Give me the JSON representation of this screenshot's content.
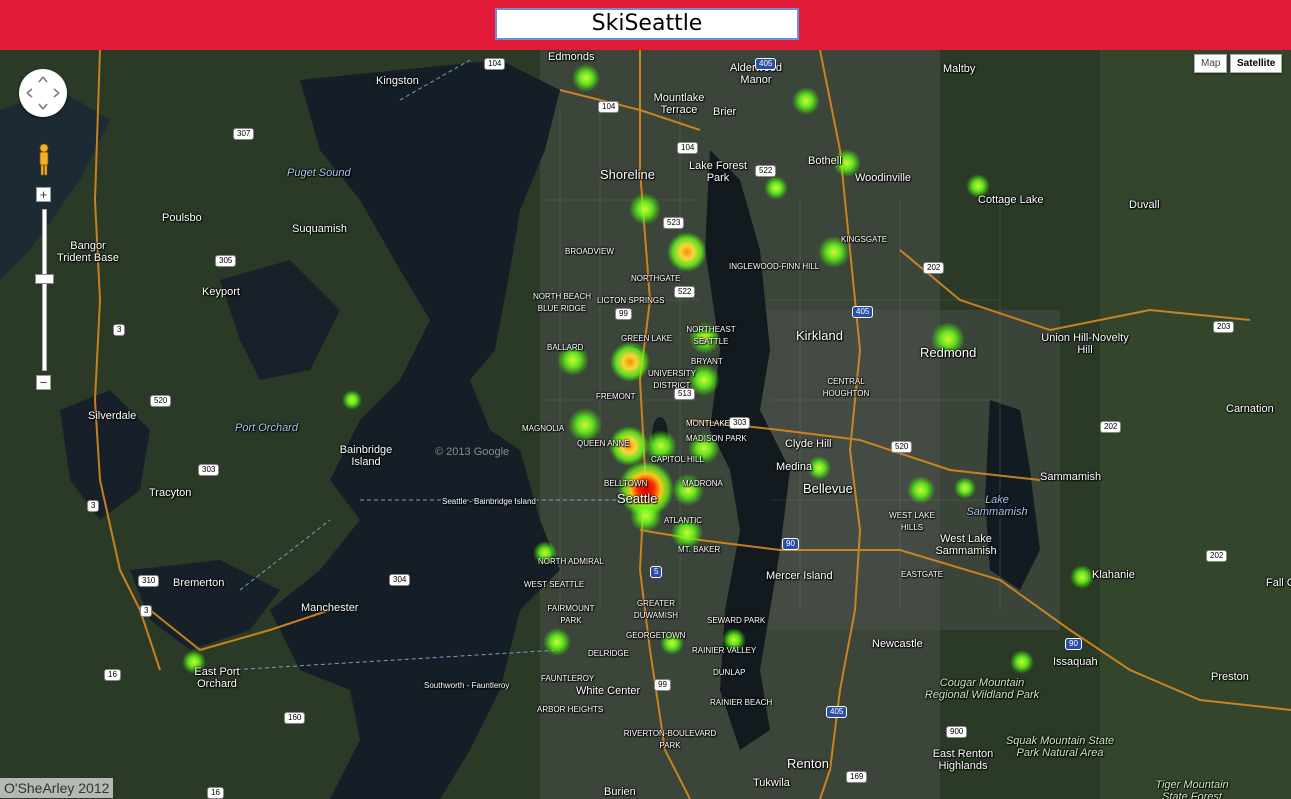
{
  "app": {
    "title": "SkiSeattle"
  },
  "map_type": {
    "map_label": "Map",
    "satellite_label": "Satellite",
    "active": "Satellite"
  },
  "zoom": {
    "in_label": "+",
    "out_label": "−"
  },
  "footer": {
    "copyright": "O'SheArley 2012"
  },
  "colors": {
    "header": "#e31b38",
    "heat_low": "#7cff2a",
    "heat_high": "#ff1a00"
  },
  "places": [
    "Edmonds",
    "Kingston",
    "Alderwood Manor",
    "Mountlake Terrace",
    "Brier",
    "Maltby",
    "Shoreline",
    "Lake Forest Park",
    "Bothell",
    "Woodinville",
    "Cottage Lake",
    "Duvall",
    "Puget Sound",
    "Poulsbo",
    "Suquamish",
    "Bangor Trident Base",
    "Keyport",
    "KINGSGATE",
    "INGLEWOOD-FINN HILL",
    "BROADVIEW",
    "NORTHGATE",
    "NORTH BEACH BLUE RIDGE",
    "LICTON SPRINGS",
    "Kirkland",
    "Redmond",
    "Union Hill-Novelty Hill",
    "BALLARD",
    "GREEN LAKE",
    "NORTHEAST SEATTLE",
    "BRYANT",
    "UNIVERSITY DISTRICT",
    "CENTRAL HOUGHTON",
    "Silverdale",
    "Port Orchard",
    "Bainbridge Island",
    "FREMONT",
    "MAGNOLIA",
    "QUEEN ANNE",
    "MONTLAKE",
    "MADISON PARK",
    "CAPITOL HILL",
    "Clyde Hill",
    "Medina",
    "Bellevue",
    "Carnation",
    "Sammamish",
    "Lake Sammamish",
    "Tracyton",
    "Seattle - Bainbridge Island",
    "Seattle",
    "MADRONA",
    "BELLTOWN",
    "ATLANTIC",
    "MT. BAKER",
    "WEST LAKE HILLS",
    "West Lake Sammamish",
    "NORTH ADMIRAL",
    "WEST SEATTLE",
    "FAIRMOUNT PARK",
    "GREATER DUWAMISH",
    "Mercer Island",
    "EASTGATE",
    "Klahanie",
    "Bremerton",
    "Manchester",
    "GEORGETOWN",
    "SEWARD PARK",
    "RAINIER VALLEY",
    "Newcastle",
    "Issaquah",
    "East Port Orchard",
    "DELRIDGE",
    "DUNLAP",
    "Cougar Mountain Regional Wildland Park",
    "Preston",
    "Southworth - Fauntleroy",
    "FAUNTLEROY",
    "White Center",
    "ARBOR HEIGHTS",
    "RAINIER BEACH",
    "RIVERTON-BOULEVARD PARK",
    "Renton",
    "East Renton Highlands",
    "Squak Mountain State Park Natural Area",
    "Tukwila",
    "Burien",
    "Tiger Mountain State Forest",
    "Fall City",
    "© 2013 Google"
  ],
  "routes": [
    "104",
    "405",
    "307",
    "104",
    "104",
    "522",
    "523",
    "305",
    "522",
    "202",
    "3",
    "99",
    "405",
    "203",
    "513",
    "520",
    "303",
    "520",
    "202",
    "303",
    "3",
    "90",
    "5",
    "202",
    "310",
    "304",
    "3",
    "90",
    "99",
    "16",
    "160",
    "405",
    "900",
    "169",
    "16"
  ],
  "heat_points": [
    {
      "name": "Edmonds",
      "level": 0.3
    },
    {
      "name": "Bothell North",
      "level": 0.35
    },
    {
      "name": "Bothell",
      "level": 0.4
    },
    {
      "name": "Cottage Lake",
      "level": 0.3
    },
    {
      "name": "Lake Forest Park",
      "level": 0.3
    },
    {
      "name": "Shoreline South",
      "level": 0.45
    },
    {
      "name": "Northgate",
      "level": 0.7
    },
    {
      "name": "Kingsgate",
      "level": 0.45
    },
    {
      "name": "Redmond",
      "level": 0.5
    },
    {
      "name": "Northeast Seattle",
      "level": 0.45
    },
    {
      "name": "Green Lake",
      "level": 0.7
    },
    {
      "name": "Ballard",
      "level": 0.45
    },
    {
      "name": "University District",
      "level": 0.5
    },
    {
      "name": "Queen Anne",
      "level": 0.5
    },
    {
      "name": "Capitol Hill West",
      "level": 0.7
    },
    {
      "name": "Capitol Hill",
      "level": 0.45
    },
    {
      "name": "Madison Park",
      "level": 0.45
    },
    {
      "name": "Medina",
      "level": 0.3
    },
    {
      "name": "Bellevue East",
      "level": 0.4
    },
    {
      "name": "Lake Sammamish",
      "level": 0.3
    },
    {
      "name": "Downtown Seattle",
      "level": 1.0
    },
    {
      "name": "Madrona",
      "level": 0.45
    },
    {
      "name": "Atlantic",
      "level": 0.4
    },
    {
      "name": "Mt. Baker",
      "level": 0.4
    },
    {
      "name": "West Seattle",
      "level": 0.3
    },
    {
      "name": "Fairmount Park",
      "level": 0.35
    },
    {
      "name": "Georgetown",
      "level": 0.3
    },
    {
      "name": "Rainier Valley",
      "level": 0.3
    },
    {
      "name": "Klahanie",
      "level": 0.3
    },
    {
      "name": "Issaquah",
      "level": 0.3
    },
    {
      "name": "East Port Orchard",
      "level": 0.3
    },
    {
      "name": "Bainbridge Island",
      "level": 0.25
    }
  ]
}
